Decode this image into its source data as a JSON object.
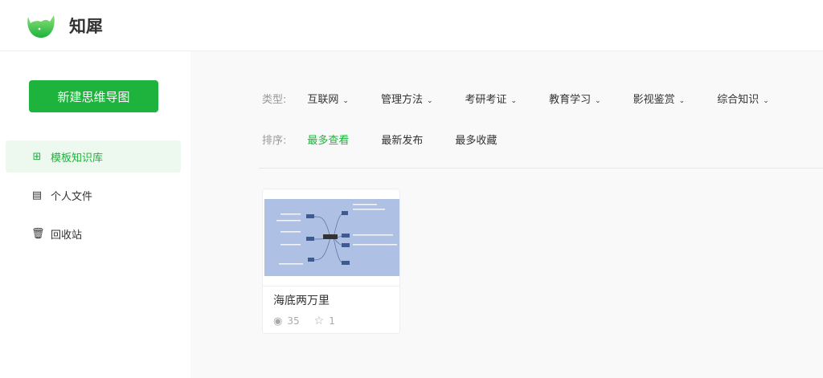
{
  "header": {
    "brand": "知犀"
  },
  "sidebar": {
    "new_button": "新建思维导图",
    "items": [
      {
        "label": "模板知识库",
        "icon": "grid-icon"
      },
      {
        "label": "个人文件",
        "icon": "file-icon"
      },
      {
        "label": "回收站",
        "icon": "trash-icon"
      }
    ]
  },
  "filters": {
    "type_label": "类型:",
    "types": [
      "互联网",
      "管理方法",
      "考研考证",
      "教育学习",
      "影视鉴赏",
      "综合知识"
    ],
    "sort_label": "排序:",
    "sorts": [
      "最多查看",
      "最新发布",
      "最多收藏"
    ]
  },
  "cards": [
    {
      "title": "海底两万里",
      "views": "35",
      "stars": "1"
    }
  ],
  "colors": {
    "accent": "#1db33c"
  }
}
